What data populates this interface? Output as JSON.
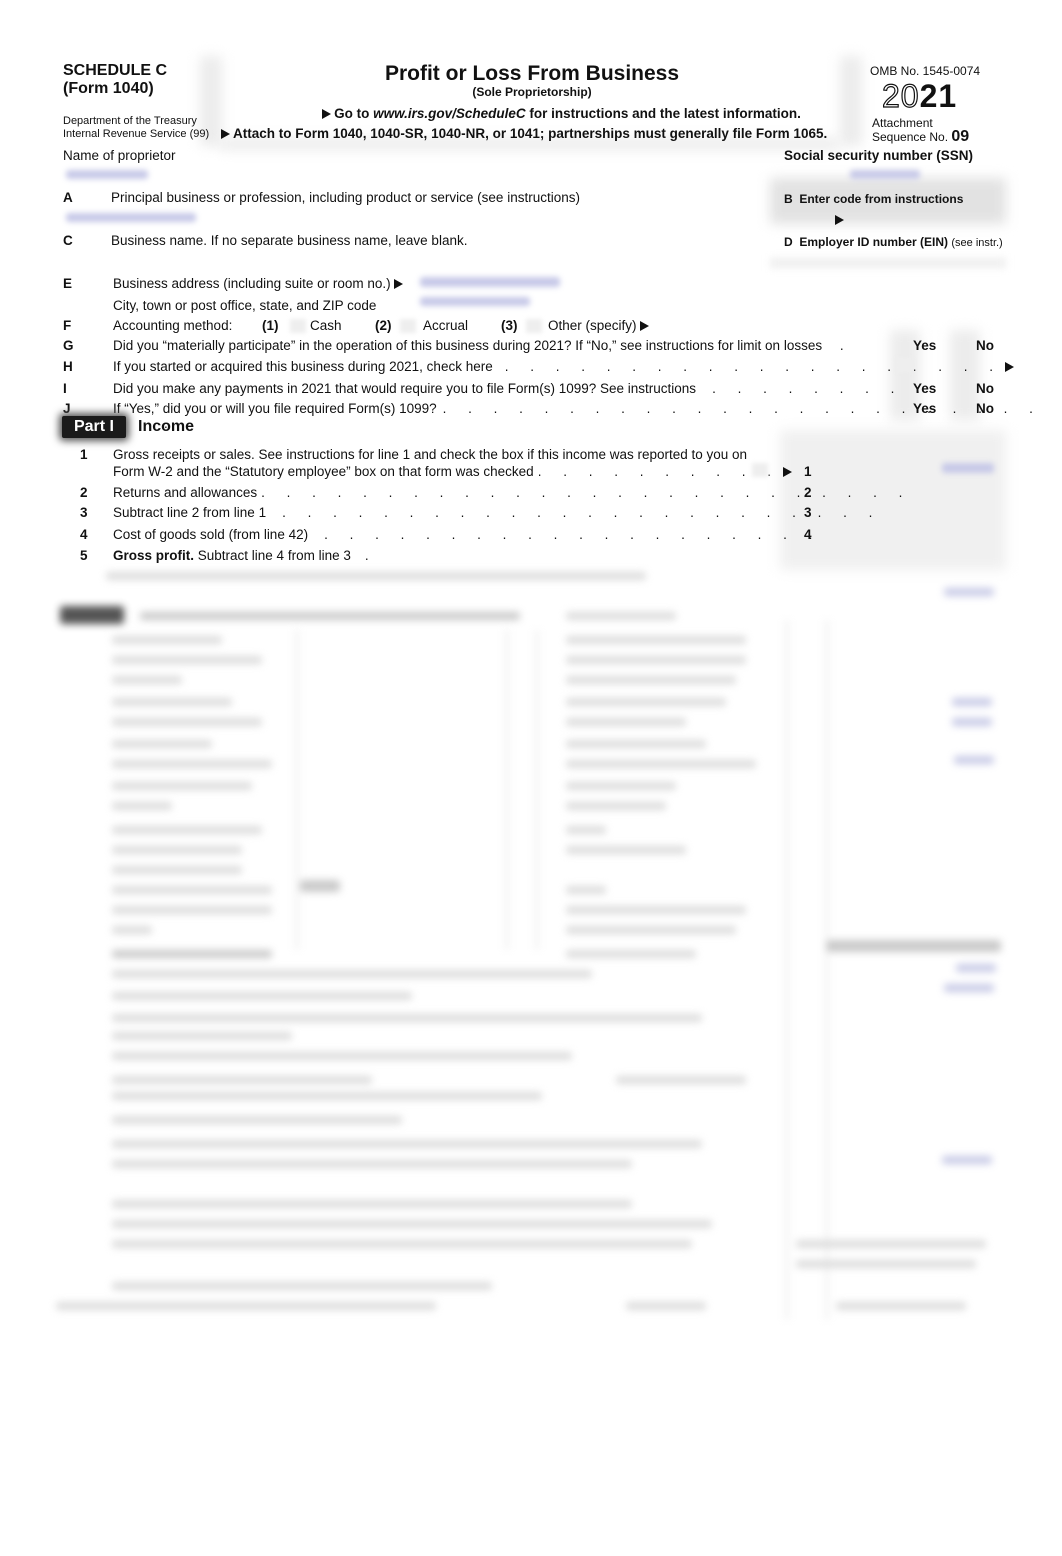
{
  "header": {
    "schedule": "SCHEDULE C",
    "form": "(Form 1040)",
    "dept_line1": "Department of the Treasury",
    "dept_line2": "Internal Revenue Service (99)",
    "title": "Profit or Loss From Business",
    "subtitle": "(Sole Proprietorship)",
    "goto_prefix": "Go to ",
    "goto_url": "www.irs.gov/ScheduleC",
    "goto_suffix": " for instructions and the latest information.",
    "attach": "Attach to Form 1040, 1040-SR, 1040-NR, or 1041; partnerships must generally file Form 1065.",
    "omb": "OMB No. 1545-0074",
    "year_outline": "20",
    "year_bold": "21",
    "attachment": "Attachment",
    "sequence_label": "Sequence No.",
    "sequence_no": "09"
  },
  "fields": {
    "name_label": "Name of proprietor",
    "ssn_label": "Social security number (SSN)",
    "A_letter": "A",
    "A_label": "Principal business or profession, including product or service (see instructions)",
    "B_letter": "B",
    "B_label": "Enter code from instructions",
    "C_letter": "C",
    "C_label": "Business name. If no separate business name, leave blank.",
    "D_letter": "D",
    "D_label_bold": "Employer ID number (EIN)",
    "D_label_suffix": "(see instr.)",
    "E_letter": "E",
    "E_label": "Business address (including suite or room no.)",
    "E_city_label": "City, town or post office, state, and ZIP code",
    "F_letter": "F",
    "F_label": "Accounting method:",
    "F_opt1_num": "(1)",
    "F_opt1": "Cash",
    "F_opt2_num": "(2)",
    "F_opt2": "Accrual",
    "F_opt3_num": "(3)",
    "F_opt3": "Other (specify)",
    "G_letter": "G",
    "G_label": "Did you “materially participate” in the operation of this business during 2021? If “No,” see instructions for limit on losses",
    "H_letter": "H",
    "H_label": "If you started or acquired this business during 2021, check here",
    "I_letter": "I",
    "I_label": "Did you make any payments in 2021 that would require you to file Form(s) 1099? See instructions",
    "J_letter": "J",
    "J_label": "If “Yes,” did you or will you file required Form(s) 1099?",
    "yes": "Yes",
    "no": "No"
  },
  "part1": {
    "badge": "Part I",
    "title": "Income",
    "lines": [
      {
        "num": "1",
        "text_line1": "Gross receipts or sales. See instructions for line 1 and check the box if this income was reported to you on",
        "text_line2": "Form W-2 and the “Statutory employee” box on that form was checked",
        "box": "1"
      },
      {
        "num": "2",
        "text": "Returns and allowances",
        "box": "2"
      },
      {
        "num": "3",
        "text": "Subtract line 2 from line 1",
        "box": "3"
      },
      {
        "num": "4",
        "text": "Cost of goods sold (from line 42)",
        "box": "4"
      },
      {
        "num": "5",
        "text_bold": "Gross profit.",
        "text": " Subtract line 4 from line 3"
      }
    ]
  }
}
